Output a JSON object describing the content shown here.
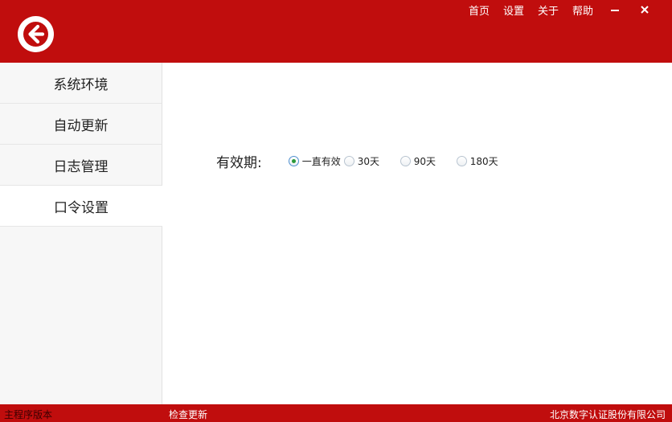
{
  "header": {
    "back_icon": "arrow-left-circle-icon",
    "nav": {
      "home": "首页",
      "settings": "设置",
      "about": "关于",
      "help": "帮助"
    },
    "minimize_glyph": "–",
    "close_glyph": "✕",
    "brand_color": "#c00d0d"
  },
  "sidebar": {
    "items": [
      {
        "label": "系统环境"
      },
      {
        "label": "自动更新"
      },
      {
        "label": "日志管理"
      },
      {
        "label": "口令设置",
        "active": true
      }
    ]
  },
  "main": {
    "validity": {
      "label": "有效期:",
      "selected": "一直有效",
      "options": [
        {
          "label": "一直有效"
        },
        {
          "label": "30天"
        },
        {
          "label": "90天"
        },
        {
          "label": "180天"
        }
      ]
    }
  },
  "status": {
    "version_label": "主程序版本",
    "check_update": "检查更新",
    "company": "北京数字认证股份有限公司"
  }
}
